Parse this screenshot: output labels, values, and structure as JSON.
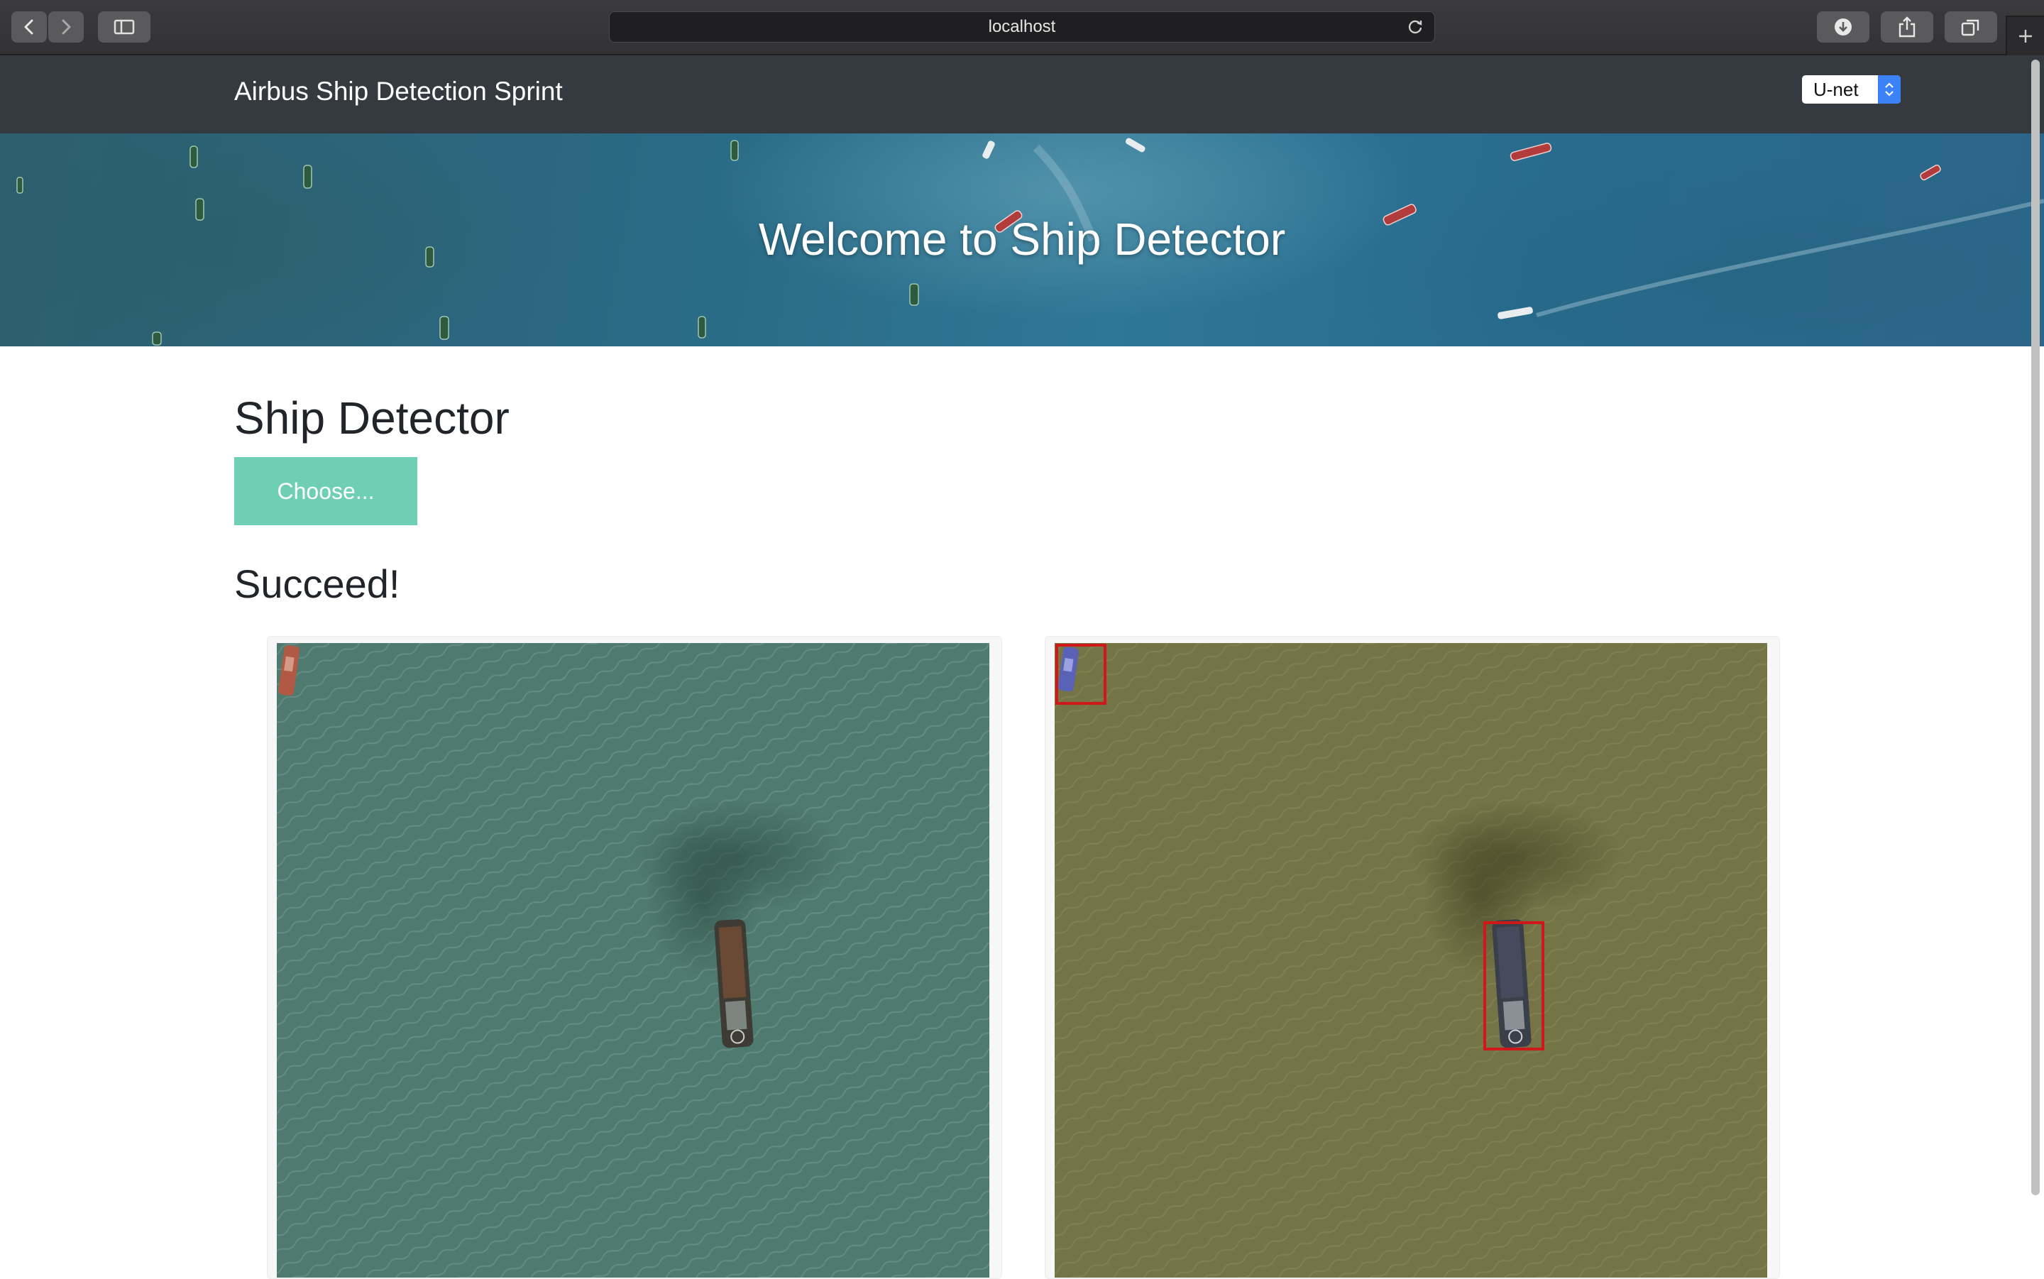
{
  "browser": {
    "url": "localhost",
    "icons": [
      "back-icon",
      "forward-icon",
      "sidebar-icon",
      "reload-icon",
      "download-icon",
      "share-icon",
      "tabs-icon",
      "plus-icon"
    ]
  },
  "navbar": {
    "brand": "Airbus Ship Detection Sprint",
    "model_select": {
      "value": "U-net"
    }
  },
  "hero": {
    "title": "Welcome to Ship Detector"
  },
  "main": {
    "title": "Ship Detector",
    "choose_button": "Choose...",
    "status": "Succeed!"
  },
  "results": [
    {
      "kind": "original",
      "detections": 0
    },
    {
      "kind": "detected",
      "detections": 2
    }
  ],
  "colors": {
    "navbar": "#343a40",
    "button": "#6ecfb4",
    "detection_box": "#d0181a",
    "text": "#212529"
  }
}
